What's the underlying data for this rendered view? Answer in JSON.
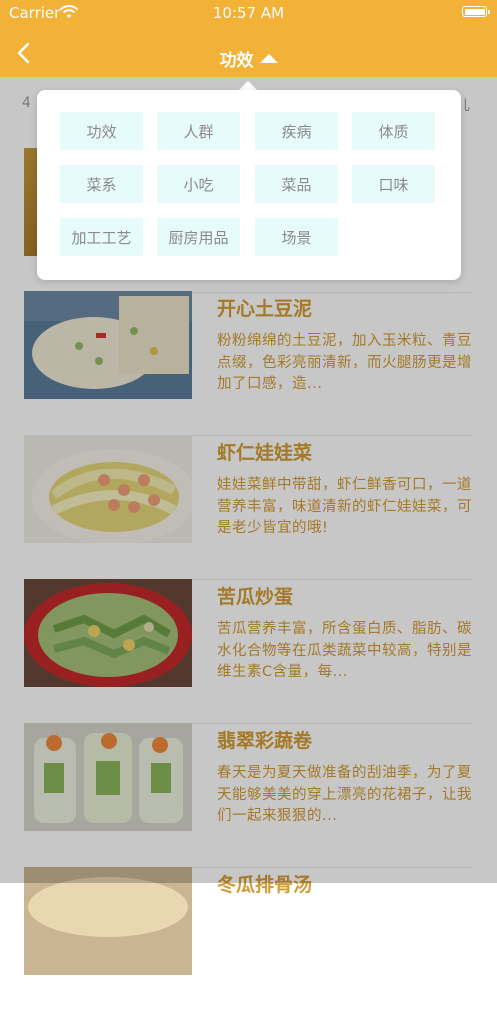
{
  "status_bar": {
    "carrier": "Carrier",
    "time": "10:57 AM"
  },
  "nav": {
    "title": "功效",
    "back_icon": "chevron-left-icon",
    "caret_icon": "caret-up-icon"
  },
  "background_hint": {
    "left_char": "4",
    "right_char": "儿"
  },
  "recipes": [
    {
      "title": "开心土豆泥",
      "desc": "粉粉绵绵的土豆泥，加入玉米粒、青豆点缀，色彩亮丽清新，而火腿肠更是增加了口感，造..."
    },
    {
      "title": "虾仁娃娃菜",
      "desc": "娃娃菜鲜中带甜，虾仁鲜香可口，一道营养丰富，味道清新的虾仁娃娃菜，可是老少皆宜的哦!"
    },
    {
      "title": "苦瓜炒蛋",
      "desc": "苦瓜营养丰富，所含蛋白质、脂肪、碳水化合物等在瓜类蔬菜中较高，特别是维生素C含量，每..."
    },
    {
      "title": "翡翠彩蔬卷",
      "desc": "春天是为夏天做准备的刮油季，为了夏天能够美美的穿上漂亮的花裙子，让我们一起来狠狠的..."
    },
    {
      "title": "冬瓜排骨汤",
      "desc": ""
    }
  ],
  "categories": [
    "功效",
    "人群",
    "疾病",
    "体质",
    "菜系",
    "小吃",
    "菜品",
    "口味",
    "加工工艺",
    "厨房用品",
    "场景"
  ],
  "colors": {
    "accent": "#f2b137",
    "text_accent": "#d39b33",
    "chip_bg": "#e7fbfb"
  }
}
